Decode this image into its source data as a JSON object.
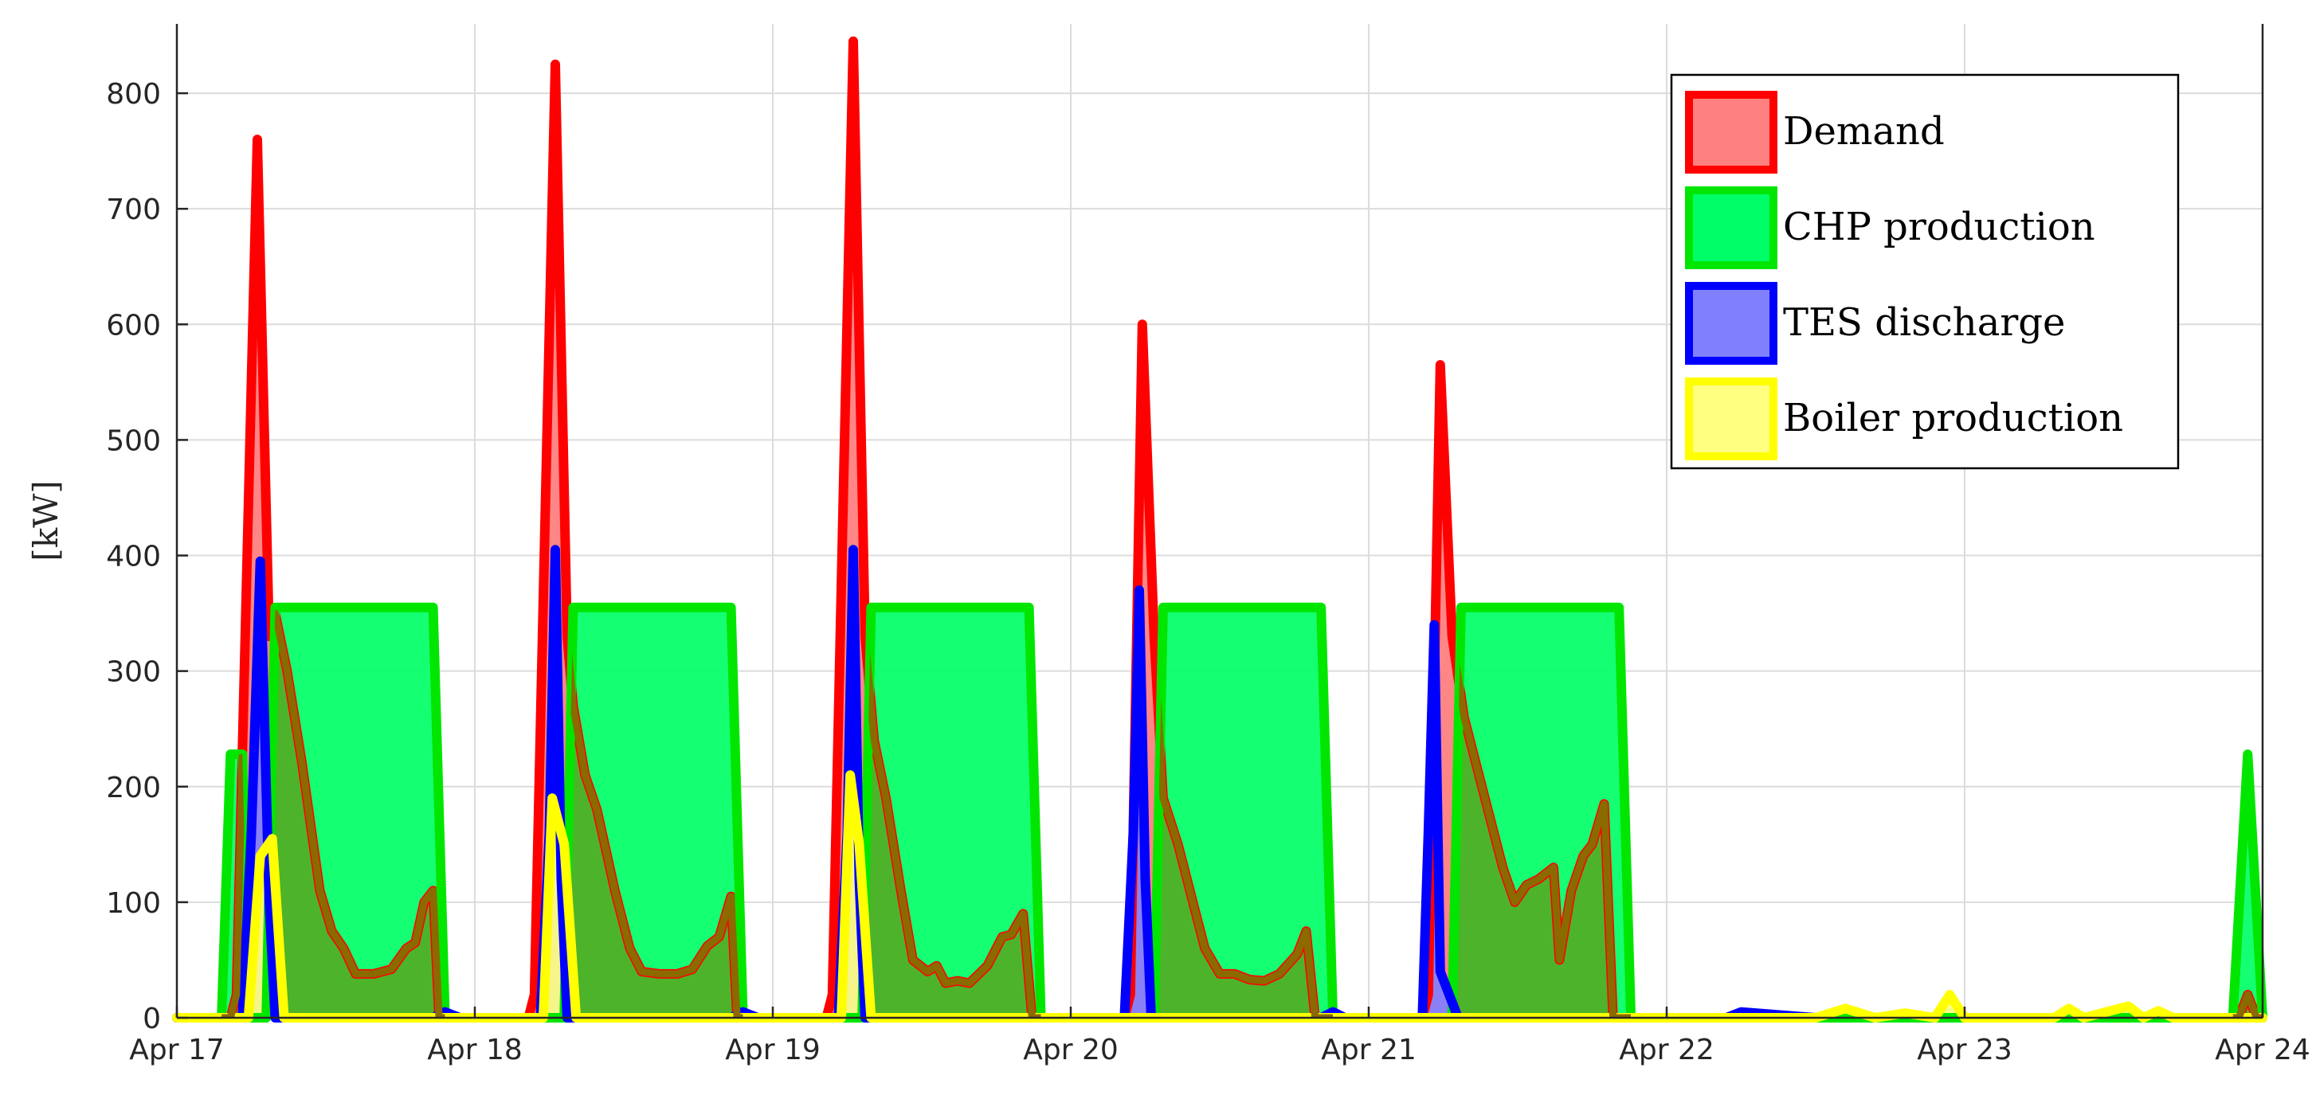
{
  "chart_data": {
    "type": "area",
    "title": "",
    "xlabel": "",
    "ylabel": "[kW]",
    "xlim": [
      "Apr 17",
      "Apr 24"
    ],
    "ylim": [
      0,
      860
    ],
    "x_ticks": [
      "Apr 17",
      "Apr 18",
      "Apr 19",
      "Apr 20",
      "Apr 21",
      "Apr 22",
      "Apr 23",
      "Apr 24"
    ],
    "y_ticks": [
      0,
      100,
      200,
      300,
      400,
      500,
      600,
      700,
      800
    ],
    "grid": true,
    "legend_position": "top-right",
    "x_unit": "days from Apr 17 00:00",
    "series": [
      {
        "name": "Demand",
        "line_color": "#ff0000",
        "fill_color": "#ff8080",
        "points": [
          [
            0,
            0
          ],
          [
            0.18,
            0
          ],
          [
            0.2,
            20
          ],
          [
            0.27,
            760
          ],
          [
            0.31,
            330
          ],
          [
            0.33,
            350
          ],
          [
            0.37,
            300
          ],
          [
            0.42,
            220
          ],
          [
            0.48,
            110
          ],
          [
            0.52,
            75
          ],
          [
            0.56,
            60
          ],
          [
            0.6,
            38
          ],
          [
            0.66,
            38
          ],
          [
            0.72,
            42
          ],
          [
            0.77,
            60
          ],
          [
            0.8,
            65
          ],
          [
            0.83,
            100
          ],
          [
            0.86,
            110
          ],
          [
            0.88,
            0
          ],
          [
            1.18,
            0
          ],
          [
            1.2,
            20
          ],
          [
            1.27,
            825
          ],
          [
            1.31,
            330
          ],
          [
            1.33,
            270
          ],
          [
            1.37,
            210
          ],
          [
            1.41,
            180
          ],
          [
            1.47,
            110
          ],
          [
            1.52,
            60
          ],
          [
            1.56,
            40
          ],
          [
            1.62,
            38
          ],
          [
            1.68,
            38
          ],
          [
            1.73,
            42
          ],
          [
            1.78,
            62
          ],
          [
            1.82,
            70
          ],
          [
            1.86,
            105
          ],
          [
            1.88,
            0
          ],
          [
            2.18,
            0
          ],
          [
            2.2,
            20
          ],
          [
            2.27,
            845
          ],
          [
            2.31,
            330
          ],
          [
            2.34,
            240
          ],
          [
            2.38,
            190
          ],
          [
            2.43,
            110
          ],
          [
            2.47,
            50
          ],
          [
            2.52,
            40
          ],
          [
            2.55,
            45
          ],
          [
            2.58,
            30
          ],
          [
            2.62,
            32
          ],
          [
            2.66,
            30
          ],
          [
            2.72,
            45
          ],
          [
            2.77,
            70
          ],
          [
            2.8,
            72
          ],
          [
            2.84,
            90
          ],
          [
            2.87,
            0
          ],
          [
            3.18,
            0
          ],
          [
            3.2,
            20
          ],
          [
            3.24,
            600
          ],
          [
            3.28,
            330
          ],
          [
            3.31,
            190
          ],
          [
            3.36,
            150
          ],
          [
            3.41,
            100
          ],
          [
            3.45,
            60
          ],
          [
            3.5,
            38
          ],
          [
            3.55,
            38
          ],
          [
            3.6,
            33
          ],
          [
            3.65,
            32
          ],
          [
            3.7,
            38
          ],
          [
            3.76,
            55
          ],
          [
            3.79,
            75
          ],
          [
            3.82,
            0
          ],
          [
            4.18,
            0
          ],
          [
            4.2,
            20
          ],
          [
            4.24,
            565
          ],
          [
            4.28,
            330
          ],
          [
            4.32,
            260
          ],
          [
            4.36,
            220
          ],
          [
            4.41,
            170
          ],
          [
            4.45,
            130
          ],
          [
            4.49,
            100
          ],
          [
            4.53,
            115
          ],
          [
            4.57,
            120
          ],
          [
            4.62,
            130
          ],
          [
            4.64,
            50
          ],
          [
            4.68,
            110
          ],
          [
            4.72,
            140
          ],
          [
            4.75,
            150
          ],
          [
            4.79,
            185
          ],
          [
            4.82,
            0
          ],
          [
            6.92,
            0
          ],
          [
            6.95,
            20
          ],
          [
            6.98,
            0
          ],
          [
            7.0,
            0
          ]
        ]
      },
      {
        "name": "CHP production",
        "line_color": "#00e600",
        "fill_color": "#00ff66",
        "points": [
          [
            0,
            0
          ],
          [
            0.15,
            0
          ],
          [
            0.18,
            228
          ],
          [
            0.22,
            228
          ],
          [
            0.24,
            0
          ],
          [
            0.3,
            0
          ],
          [
            0.33,
            355
          ],
          [
            0.86,
            355
          ],
          [
            0.9,
            0
          ],
          [
            1.3,
            0
          ],
          [
            1.33,
            355
          ],
          [
            1.86,
            355
          ],
          [
            1.9,
            0
          ],
          [
            2.3,
            0
          ],
          [
            2.33,
            355
          ],
          [
            2.86,
            355
          ],
          [
            2.9,
            0
          ],
          [
            3.28,
            0
          ],
          [
            3.31,
            355
          ],
          [
            3.84,
            355
          ],
          [
            3.88,
            0
          ],
          [
            4.28,
            0
          ],
          [
            4.31,
            355
          ],
          [
            4.84,
            355
          ],
          [
            4.88,
            0
          ],
          [
            6.9,
            0
          ],
          [
            6.95,
            228
          ],
          [
            7.0,
            0
          ]
        ]
      },
      {
        "name": "TES discharge",
        "line_color": "#0000ff",
        "fill_color": "#8080ff",
        "points": [
          [
            0,
            0
          ],
          [
            0.22,
            0
          ],
          [
            0.25,
            160
          ],
          [
            0.28,
            395
          ],
          [
            0.31,
            100
          ],
          [
            0.33,
            0
          ],
          [
            0.86,
            0
          ],
          [
            0.9,
            5
          ],
          [
            0.95,
            0
          ],
          [
            1.22,
            0
          ],
          [
            1.25,
            160
          ],
          [
            1.27,
            405
          ],
          [
            1.29,
            120
          ],
          [
            1.31,
            0
          ],
          [
            1.86,
            0
          ],
          [
            1.9,
            5
          ],
          [
            1.95,
            0
          ],
          [
            2.22,
            0
          ],
          [
            2.25,
            160
          ],
          [
            2.27,
            405
          ],
          [
            2.29,
            120
          ],
          [
            2.31,
            0
          ],
          [
            3.18,
            0
          ],
          [
            3.21,
            160
          ],
          [
            3.23,
            370
          ],
          [
            3.25,
            120
          ],
          [
            3.27,
            0
          ],
          [
            3.84,
            0
          ],
          [
            3.88,
            5
          ],
          [
            3.92,
            0
          ],
          [
            4.18,
            0
          ],
          [
            4.2,
            160
          ],
          [
            4.22,
            340
          ],
          [
            4.24,
            40
          ],
          [
            4.3,
            0
          ],
          [
            5.2,
            0
          ],
          [
            5.25,
            5
          ],
          [
            5.5,
            0
          ]
        ]
      },
      {
        "name": "Boiler production",
        "line_color": "#ffff00",
        "fill_color": "#ffff80",
        "points": [
          [
            0,
            0
          ],
          [
            0.24,
            0
          ],
          [
            0.28,
            140
          ],
          [
            0.32,
            155
          ],
          [
            0.36,
            0
          ],
          [
            1.23,
            0
          ],
          [
            1.26,
            190
          ],
          [
            1.3,
            150
          ],
          [
            1.34,
            0
          ],
          [
            2.23,
            0
          ],
          [
            2.26,
            210
          ],
          [
            2.29,
            150
          ],
          [
            2.33,
            0
          ],
          [
            5.5,
            0
          ],
          [
            5.6,
            8
          ],
          [
            5.7,
            0
          ],
          [
            5.8,
            4
          ],
          [
            5.9,
            0
          ],
          [
            5.95,
            20
          ],
          [
            6.0,
            0
          ],
          [
            6.3,
            0
          ],
          [
            6.35,
            8
          ],
          [
            6.4,
            0
          ],
          [
            6.55,
            10
          ],
          [
            6.6,
            0
          ],
          [
            6.65,
            6
          ],
          [
            6.7,
            0
          ],
          [
            7.0,
            0
          ]
        ]
      }
    ]
  },
  "overlay": {
    "name": "Demand minus supply (brown overlap)",
    "line_color": "#8b6a00",
    "fill_color": "#4db32b"
  }
}
